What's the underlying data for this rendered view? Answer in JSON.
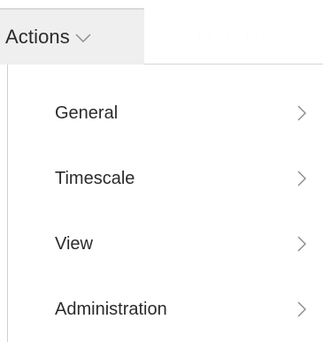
{
  "toolbar": {
    "actions_label": "Actions",
    "actions_icon": "chevron-down-icon",
    "faint_label": "· · · · · · · ·"
  },
  "menu": {
    "items": [
      {
        "label": "General",
        "icon": "chevron-right-icon"
      },
      {
        "label": "Timescale",
        "icon": "chevron-right-icon"
      },
      {
        "label": "View",
        "icon": "chevron-right-icon"
      },
      {
        "label": "Administration",
        "icon": "chevron-right-icon"
      }
    ]
  },
  "colors": {
    "button_bg": "#efefef",
    "text": "#2b2b2b",
    "icon": "#8a8a8a",
    "border": "#d0d0d0"
  }
}
